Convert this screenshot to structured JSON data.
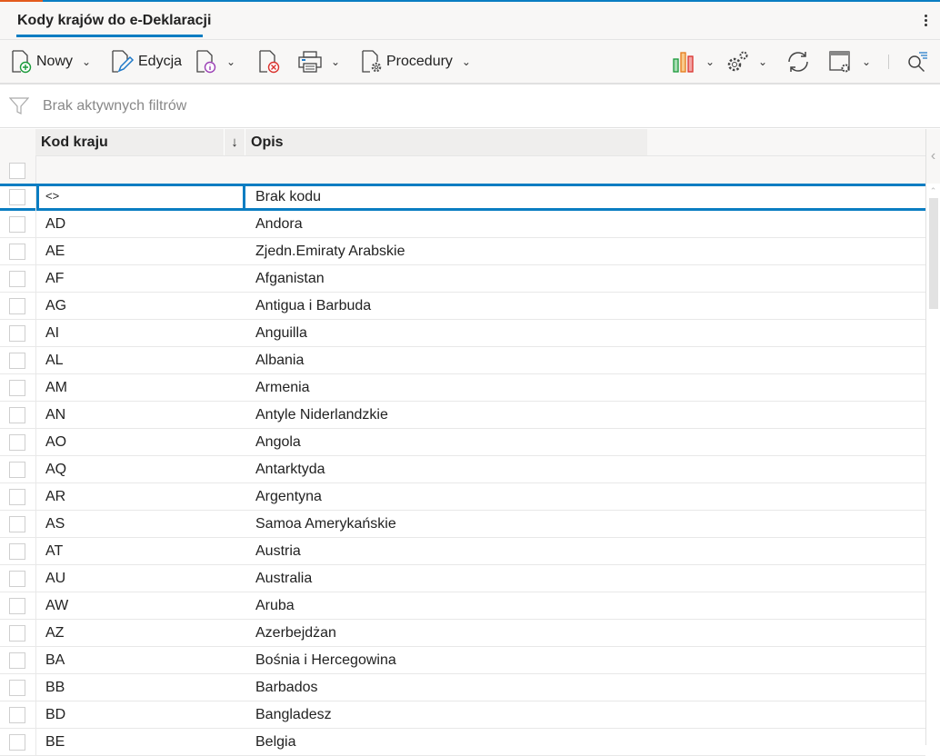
{
  "title": "Kody krajów do e-Deklaracji",
  "toolbar": {
    "new": "Nowy",
    "edit": "Edycja",
    "procedures": "Procedury"
  },
  "filter": {
    "text": "Brak aktywnych filtrów"
  },
  "columns": {
    "code": "Kod kraju",
    "desc": "Opis"
  },
  "rows": [
    {
      "code": "<>",
      "desc": "Brak kodu"
    },
    {
      "code": "AD",
      "desc": "Andora"
    },
    {
      "code": "AE",
      "desc": "Zjedn.Emiraty Arabskie"
    },
    {
      "code": "AF",
      "desc": "Afganistan"
    },
    {
      "code": "AG",
      "desc": "Antigua i Barbuda"
    },
    {
      "code": "AI",
      "desc": "Anguilla"
    },
    {
      "code": "AL",
      "desc": "Albania"
    },
    {
      "code": "AM",
      "desc": "Armenia"
    },
    {
      "code": "AN",
      "desc": "Antyle Niderlandzkie"
    },
    {
      "code": "AO",
      "desc": "Angola"
    },
    {
      "code": "AQ",
      "desc": "Antarktyda"
    },
    {
      "code": "AR",
      "desc": "Argentyna"
    },
    {
      "code": "AS",
      "desc": "Samoa Amerykańskie"
    },
    {
      "code": "AT",
      "desc": "Austria"
    },
    {
      "code": "AU",
      "desc": "Australia"
    },
    {
      "code": "AW",
      "desc": "Aruba"
    },
    {
      "code": "AZ",
      "desc": "Azerbejdżan"
    },
    {
      "code": "BA",
      "desc": "Bośnia i Hercegowina"
    },
    {
      "code": "BB",
      "desc": "Barbados"
    },
    {
      "code": "BD",
      "desc": "Bangladesz"
    },
    {
      "code": "BE",
      "desc": "Belgia"
    }
  ],
  "colors": {
    "accent": "#0a7dc2",
    "accent2": "#e35b1c"
  }
}
